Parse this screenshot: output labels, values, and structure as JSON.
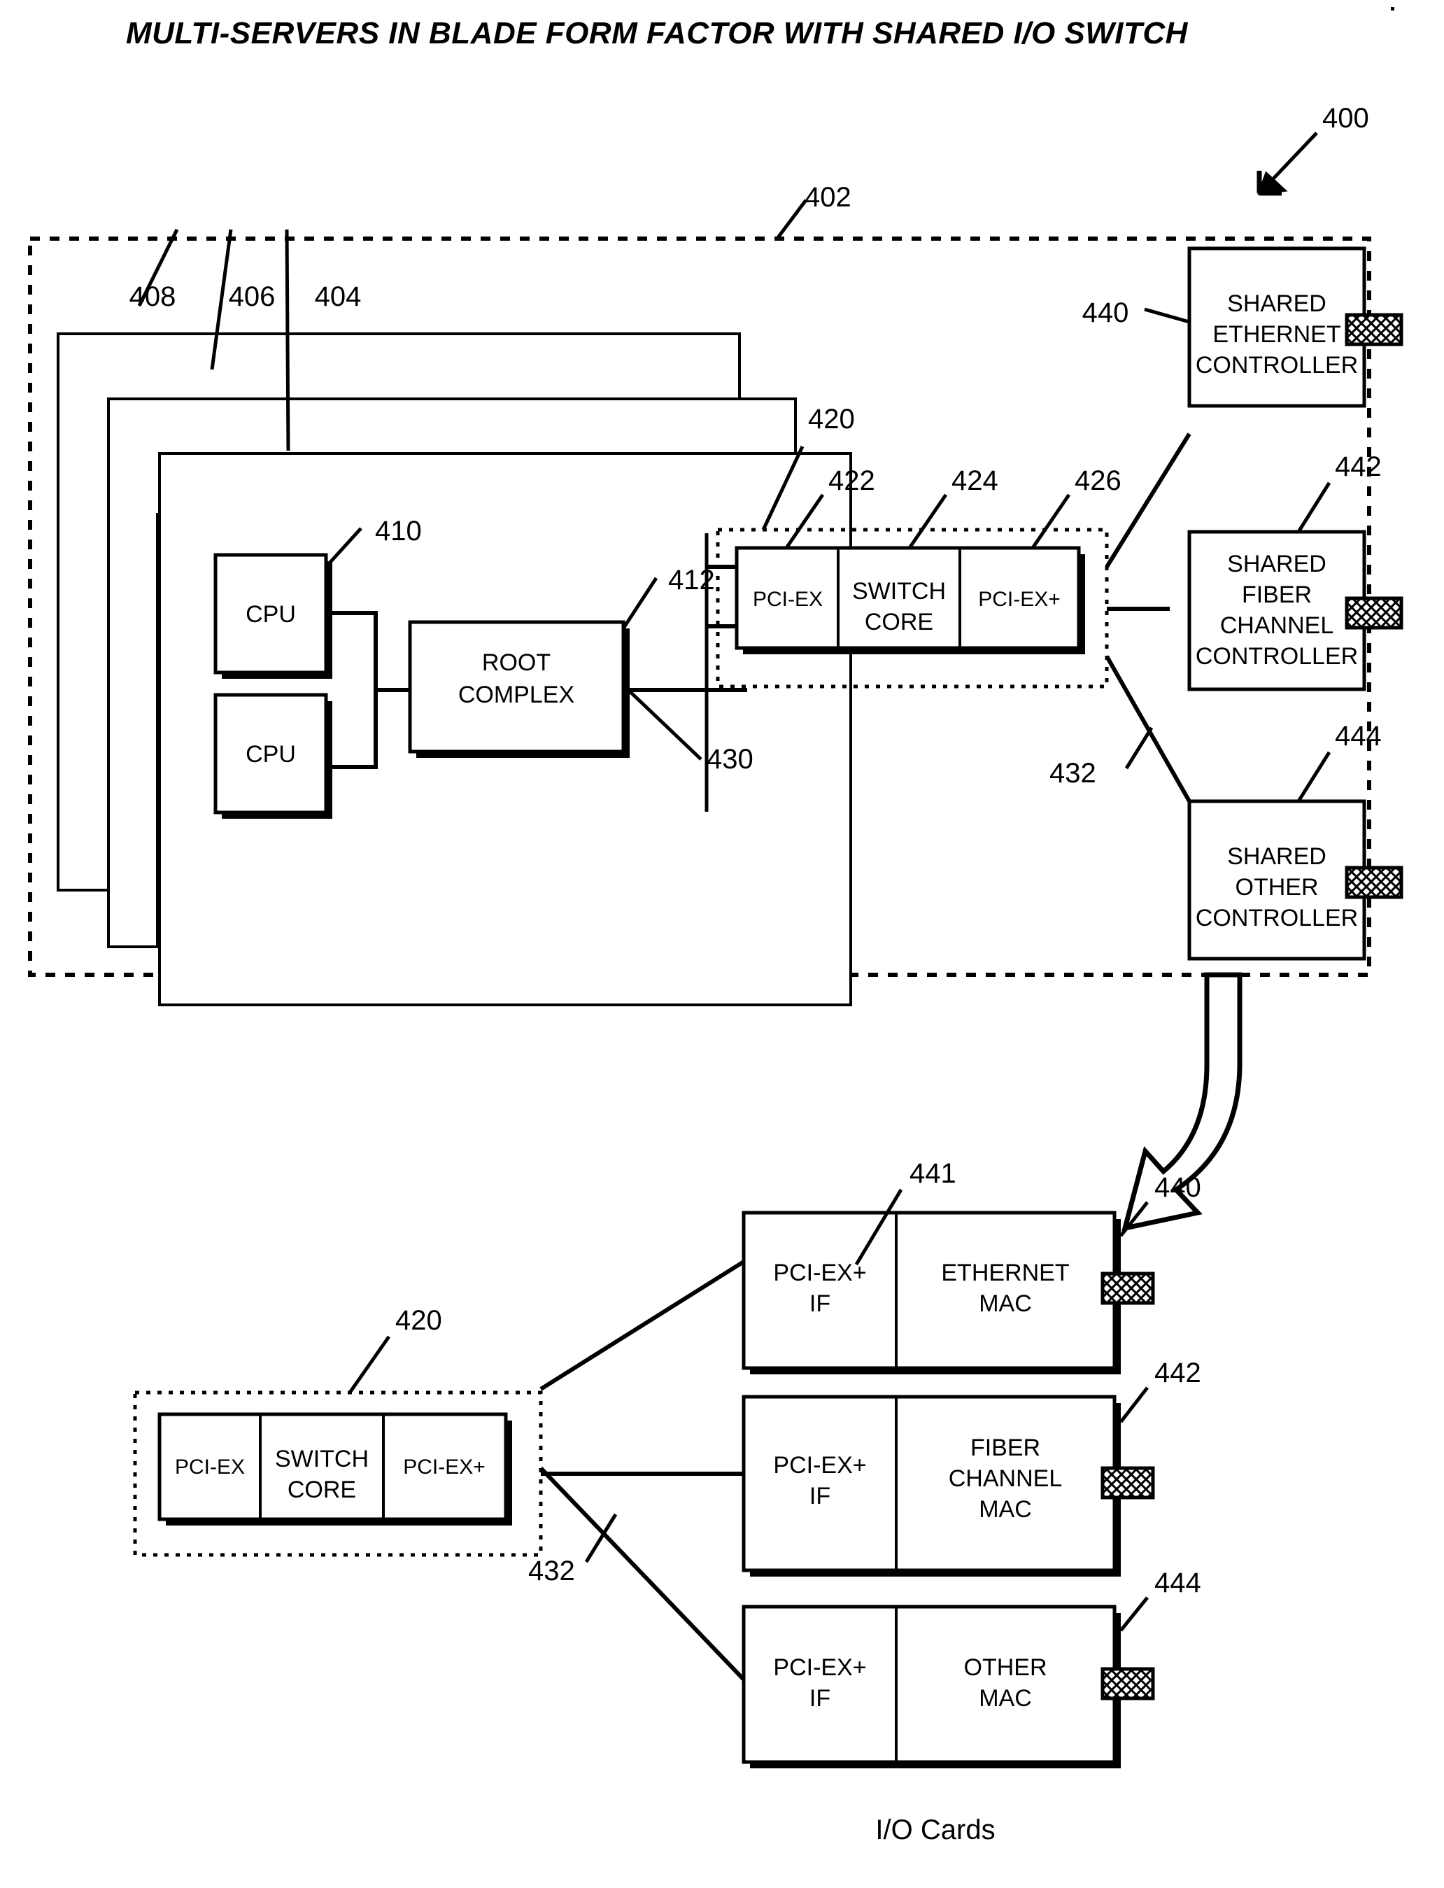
{
  "figure": {
    "title": "MULTI-SERVERS IN BLADE FORM FACTOR WITH SHARED I/O SWITCH",
    "caption_bottom": "I/O Cards",
    "ref_400": "400",
    "ref_402": "402"
  },
  "blades": {
    "ref_back": "408",
    "ref_mid": "406",
    "ref_front": "404",
    "cpu_ref": "410",
    "cpu_label_1": "CPU",
    "cpu_label_2": "CPU",
    "root_complex_ref": "412",
    "root_complex_line1": "ROOT",
    "root_complex_line2": "COMPLEX"
  },
  "switch_top": {
    "ref_enclosure": "420",
    "ref_pciex": "422",
    "ref_core": "424",
    "ref_pciexplus": "426",
    "seg_pciex": "PCI-EX",
    "seg_core_line1": "SWITCH",
    "seg_core_line2": "CORE",
    "seg_pciexplus": "PCI-EX+",
    "ref_link_in": "430",
    "ref_link_out": "432"
  },
  "controllers": [
    {
      "ref": "440",
      "line1": "SHARED",
      "line2": "ETHERNET",
      "line3": "CONTROLLER",
      "line4": ""
    },
    {
      "ref": "442",
      "line1": "SHARED",
      "line2": "FIBER",
      "line3": "CHANNEL",
      "line4": "CONTROLLER"
    },
    {
      "ref": "444",
      "line1": "SHARED",
      "line2": "OTHER",
      "line3": "CONTROLLER",
      "line4": ""
    }
  ],
  "switch_bottom": {
    "ref_enclosure": "420",
    "seg_pciex": "PCI-EX",
    "seg_core_line1": "SWITCH",
    "seg_core_line2": "CORE",
    "seg_pciexplus": "PCI-EX+",
    "ref_link_out": "432"
  },
  "io_cards": [
    {
      "ref_if": "441",
      "ref_card": "440",
      "if_line1": "PCI-EX+",
      "if_line2": "IF",
      "mac_line1": "ETHERNET",
      "mac_line2": "MAC",
      "mac_line3": ""
    },
    {
      "ref_if": "",
      "ref_card": "442",
      "if_line1": "PCI-EX+",
      "if_line2": "IF",
      "mac_line1": "FIBER",
      "mac_line2": "CHANNEL",
      "mac_line3": "MAC"
    },
    {
      "ref_if": "",
      "ref_card": "444",
      "if_line1": "PCI-EX+",
      "if_line2": "IF",
      "mac_line1": "OTHER",
      "mac_line2": "MAC",
      "mac_line3": ""
    }
  ],
  "colors": {
    "ink": "#000000",
    "paper": "#ffffff"
  }
}
